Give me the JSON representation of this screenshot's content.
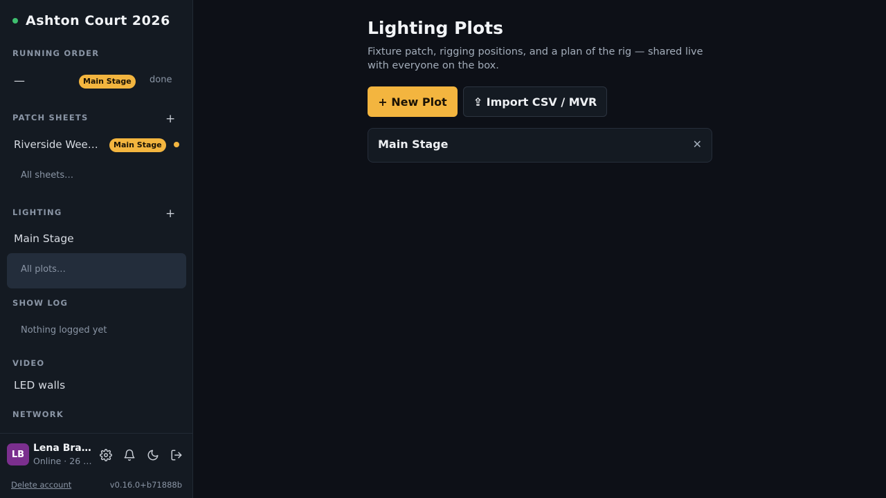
{
  "sidebar": {
    "brand": {
      "title": "Ashton Court 2026",
      "status_color": "#3fbf6f"
    },
    "running_order": {
      "heading": "RUNNING ORDER",
      "row": {
        "label": "—",
        "badge": "Main Stage",
        "status": "done"
      }
    },
    "patch_sheets": {
      "heading": "PATCH SHEETS",
      "add": "+",
      "items": [
        {
          "label": "Riverside Wee…",
          "badge": "Main Stage"
        }
      ],
      "all_link": "All sheets…"
    },
    "lighting": {
      "heading": "LIGHTING",
      "add": "+",
      "items": [
        {
          "label": "Main Stage"
        }
      ],
      "all_link": "All plots…"
    },
    "show_log": {
      "heading": "SHOW LOG",
      "empty": "Nothing logged yet"
    },
    "video": {
      "heading": "VIDEO",
      "items": [
        {
          "label": "LED walls"
        }
      ]
    },
    "network": {
      "heading": "NETWORK"
    },
    "user": {
      "initials": "LB",
      "name": "Lena Bra…",
      "status": "Online · 26 …",
      "icons": [
        "gear-icon",
        "bell-icon",
        "moon-icon",
        "logout-icon"
      ]
    },
    "footer": {
      "delete_account": "Delete account",
      "version": "v0.16.0+b71888b"
    }
  },
  "main": {
    "title": "Lighting Plots",
    "subtitle": "Fixture patch, rigging positions, and a plan of the rig — shared live with everyone on the box.",
    "actions": {
      "new_plot": "+ New Plot",
      "import": "⇪ Import CSV / MVR"
    },
    "plots": [
      {
        "title": "Main Stage",
        "close": "✕"
      }
    ]
  },
  "colors": {
    "accent": "#f3b53f",
    "background": "#0d1017",
    "sidebar": "#141a22",
    "avatar": "#7b2f8e"
  }
}
